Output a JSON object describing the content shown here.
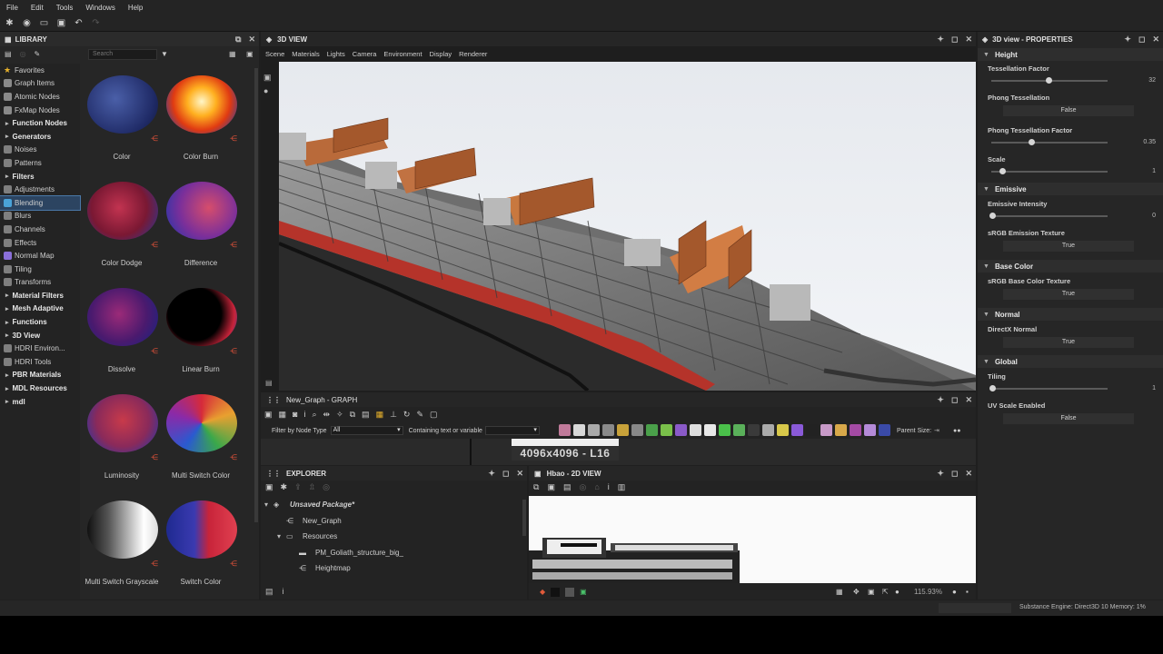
{
  "menu": [
    "File",
    "Edit",
    "Tools",
    "Windows",
    "Help"
  ],
  "library": {
    "title": "LIBRARY",
    "search_placeholder": "Search",
    "tree": [
      {
        "label": "Favorites",
        "icon": "star-icon",
        "cat": false,
        "indent": 1,
        "color": "#e8b22c"
      },
      {
        "label": "Graph Items",
        "icon": "graph-icon",
        "cat": false,
        "indent": 1,
        "color": "#8a8a8a"
      },
      {
        "label": "Atomic Nodes",
        "icon": "atomic-icon",
        "cat": false,
        "indent": 1,
        "color": "#8a8a8a"
      },
      {
        "label": "FxMap Nodes",
        "icon": "fxmap-icon",
        "cat": false,
        "indent": 1,
        "color": "#8a8a8a"
      },
      {
        "label": "Function Nodes",
        "icon": "caret-icon",
        "cat": true,
        "indent": 0,
        "color": ""
      },
      {
        "label": "Generators",
        "icon": "caret-icon",
        "cat": true,
        "indent": 0,
        "color": ""
      },
      {
        "label": "Noises",
        "icon": "noise-icon",
        "cat": false,
        "indent": 2,
        "color": "#7f7f7f"
      },
      {
        "label": "Patterns",
        "icon": "pattern-icon",
        "cat": false,
        "indent": 2,
        "color": "#7f7f7f"
      },
      {
        "label": "Filters",
        "icon": "caret-icon",
        "cat": true,
        "indent": 0,
        "color": ""
      },
      {
        "label": "Adjustments",
        "icon": "adjust-icon",
        "cat": false,
        "indent": 2,
        "color": "#7f7f7f"
      },
      {
        "label": "Blending",
        "icon": "blend-icon",
        "cat": false,
        "indent": 2,
        "color": "#4aa3d9",
        "sel": true
      },
      {
        "label": "Blurs",
        "icon": "blur-icon",
        "cat": false,
        "indent": 2,
        "color": "#7f7f7f"
      },
      {
        "label": "Channels",
        "icon": "channels-icon",
        "cat": false,
        "indent": 2,
        "color": "#7f7f7f"
      },
      {
        "label": "Effects",
        "icon": "effects-icon",
        "cat": false,
        "indent": 2,
        "color": "#7f7f7f"
      },
      {
        "label": "Normal Map",
        "icon": "normalmap-icon",
        "cat": false,
        "indent": 2,
        "color": "#8a6fd9"
      },
      {
        "label": "Tiling",
        "icon": "tiling-icon",
        "cat": false,
        "indent": 2,
        "color": "#7f7f7f"
      },
      {
        "label": "Transforms",
        "icon": "transform-icon",
        "cat": false,
        "indent": 2,
        "color": "#7f7f7f"
      },
      {
        "label": "Material Filters",
        "icon": "caret-icon",
        "cat": true,
        "indent": 0,
        "color": ""
      },
      {
        "label": "Mesh Adaptive",
        "icon": "caret-icon",
        "cat": true,
        "indent": 0,
        "color": ""
      },
      {
        "label": "Functions",
        "icon": "caret-icon",
        "cat": true,
        "indent": 0,
        "color": ""
      },
      {
        "label": "3D View",
        "icon": "caret-icon",
        "cat": true,
        "indent": 0,
        "color": ""
      },
      {
        "label": "HDRI Environ...",
        "icon": "hdri-icon",
        "cat": false,
        "indent": 2,
        "color": "#7f7f7f"
      },
      {
        "label": "HDRI Tools",
        "icon": "hdri-tools-icon",
        "cat": false,
        "indent": 2,
        "color": "#7f7f7f"
      },
      {
        "label": "PBR Materials",
        "icon": "caret-icon",
        "cat": true,
        "indent": 0,
        "color": ""
      },
      {
        "label": "MDL Resources",
        "icon": "caret-icon",
        "cat": true,
        "indent": 0,
        "color": ""
      },
      {
        "label": "mdl",
        "icon": "caret-icon",
        "cat": true,
        "indent": 0,
        "color": ""
      }
    ],
    "items": [
      {
        "label": "Color",
        "style": "radial-gradient(circle at 40% 40%,#4a5fa8,#1f2a66 70%,#101838)"
      },
      {
        "label": "Color Burn",
        "style": "radial-gradient(circle at 50% 45%,#fff6c8 0%,#ffb020 30%,#e03a12 60%,#2a3fa0 90%)"
      },
      {
        "label": "Color Dodge",
        "style": "radial-gradient(circle at 45% 45%,#c23350,#7a1833 55%,#2b3690 95%)"
      },
      {
        "label": "Difference",
        "style": "radial-gradient(circle at 60% 45%,#d64d6c,#7a2f9a 55%,#2536a8 95%)"
      },
      {
        "label": "Dissolve",
        "style": "radial-gradient(circle at 45% 45%,#9b2a78,#4a1a6e 55%,#1a2280 95%)"
      },
      {
        "label": "Linear Burn",
        "style": "radial-gradient(circle at 40% 45%,#000 0%,#000 50%,#c8243a 75%,#2a3aa8 95%)"
      },
      {
        "label": "Luminosity",
        "style": "radial-gradient(circle at 50% 45%,#c83a4a,#8a2a5a 55%,#2536a8 95%)"
      },
      {
        "label": "Multi Switch Color",
        "style": "conic-gradient(#d62a3a,#e8a030,#3aa84a,#2a5ad0,#8a2aa8,#d62a3a)"
      },
      {
        "label": "Multi Switch Grayscale",
        "style": "linear-gradient(90deg,#111 0%,#555 30%,#bbb 60%,#fff 80%,#ddd 100%)"
      },
      {
        "label": "Switch Color",
        "style": "linear-gradient(90deg,#1f2a90 0%,#3a3ab0 40%,#c8243a 60%,#e04050 100%)"
      }
    ]
  },
  "view3d": {
    "title": "3D VIEW",
    "menu": [
      "Scene",
      "Materials",
      "Lights",
      "Camera",
      "Environment",
      "Display",
      "Renderer"
    ]
  },
  "graph": {
    "title": "New_Graph - GRAPH",
    "filter_label": "Filter by Node Type",
    "filter_value": "All",
    "containing_label": "Containing text or variable",
    "parent_size_label": "Parent Size:",
    "resolution_label": "4096x4096 - L16"
  },
  "explorer": {
    "title": "EXPLORER",
    "rows": [
      {
        "label": "Unsaved Package*",
        "indent": 0,
        "italic": true
      },
      {
        "label": "New_Graph",
        "indent": 1,
        "italic": false
      },
      {
        "label": "Resources",
        "indent": 1,
        "italic": false
      },
      {
        "label": "PM_Goliath_structure_big_",
        "indent": 2,
        "italic": false
      },
      {
        "label": "Heightmap",
        "indent": 2,
        "italic": false
      }
    ]
  },
  "view2d": {
    "title": "Hbao - 2D VIEW",
    "zoom": "115.93%"
  },
  "properties": {
    "title": "3D view - PROPERTIES",
    "height_section": "Height",
    "tess_label": "Tessellation Factor",
    "tess_value": "32",
    "phong_label": "Phong Tessellation",
    "phong_value": "False",
    "phong_factor_label": "Phong Tessellation Factor",
    "phong_factor_value": "0.35",
    "scale_label": "Scale",
    "scale_value": "1",
    "emissive_section": "Emissive",
    "emissive_intensity_label": "Emissive Intensity",
    "emissive_intensity_value": "0",
    "srgb_emission_label": "sRGB Emission Texture",
    "srgb_emission_value": "True",
    "basecolor_section": "Base Color",
    "srgb_base_label": "sRGB Base Color Texture",
    "srgb_base_value": "True",
    "normal_section": "Normal",
    "directx_label": "DirectX Normal",
    "directx_value": "True",
    "global_section": "Global",
    "tiling_label": "Tiling",
    "tiling_value": "1",
    "uv_scale_label": "UV Scale Enabled",
    "uv_scale_value": "False"
  },
  "status": {
    "engine": "Substance Engine: Direct3D 10  Memory: 1%"
  }
}
